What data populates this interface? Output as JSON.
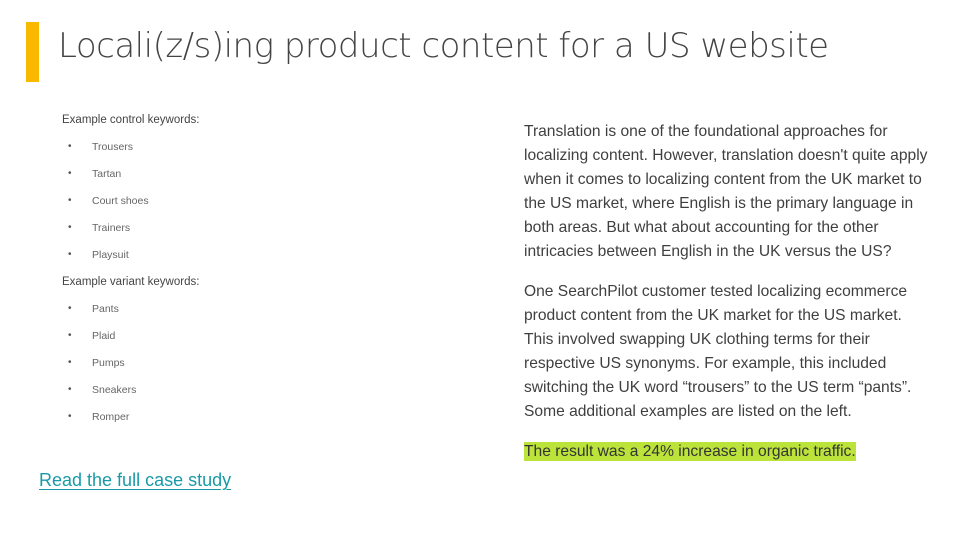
{
  "slide": {
    "title": "Locali(z/s)ing product content for a US website",
    "accent_color": "#fbb800",
    "keywords": {
      "control_heading": "Example control keywords:",
      "control_items": [
        "Trousers",
        "Tartan",
        "Court shoes",
        "Trainers",
        "Playsuit"
      ],
      "variant_heading": "Example variant keywords:",
      "variant_items": [
        "Pants",
        "Plaid",
        "Pumps",
        "Sneakers",
        "Romper"
      ]
    },
    "link_label": "Read the full case study",
    "paragraphs": [
      "Translation is one of the foundational approaches for localizing content. However, translation doesn't quite apply when it comes to localizing content from the UK market to the US market, where English is the primary language in both areas. But what about accounting for the other intricacies between English in the UK versus the US?",
      "One SearchPilot customer tested localizing ecommerce product content from the UK market for the US market. This involved swapping UK clothing terms for their respective US synonyms. For example, this included switching the UK word “trousers” to the US term “pants”. Some additional examples are listed on the left."
    ],
    "result": "The result was a 24% increase in organic traffic.",
    "highlight_color": "#bce33a",
    "link_color": "#1a9aa8"
  }
}
